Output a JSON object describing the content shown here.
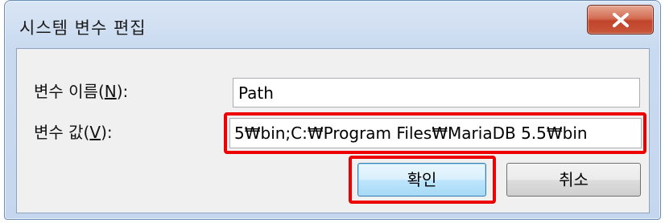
{
  "window": {
    "title": "시스템 변수 편집"
  },
  "form": {
    "name_label_prefix": "변수 이름(",
    "name_label_accel": "N",
    "name_label_suffix": "):",
    "name_value": "Path",
    "value_label_prefix": "변수 값(",
    "value_label_accel": "V",
    "value_label_suffix": "):",
    "value_value": "5₩bin;C:₩Program Files₩MariaDB 5.5₩bin"
  },
  "buttons": {
    "ok": "확인",
    "cancel": "취소"
  },
  "icons": {
    "close": "close-icon"
  },
  "colors": {
    "highlight": "#ee0000",
    "close_button": "#c8563b"
  }
}
